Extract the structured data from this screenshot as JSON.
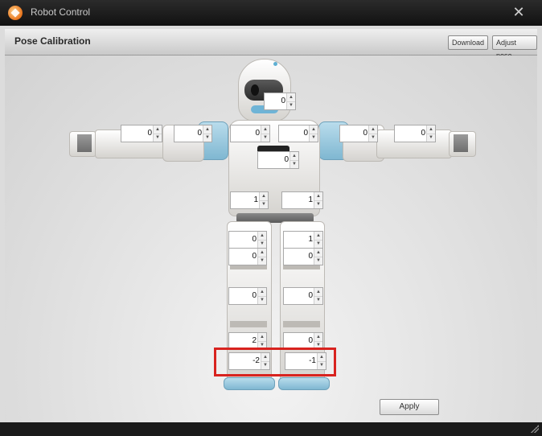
{
  "window": {
    "title": "Robot Control",
    "close_glyph": "✕"
  },
  "header": {
    "title": "Pose Calibration",
    "download_label": "Download",
    "adjust_label": "Adjust pose"
  },
  "servos": {
    "head": "0",
    "left_hand": "0",
    "left_elbow": "0",
    "left_shoulder": "0",
    "right_shoulder": "0",
    "right_elbow": "0",
    "right_hand": "0",
    "chest": "0",
    "left_hip": "1",
    "right_hip": "1",
    "left_thigh_upper": "0",
    "right_thigh_upper": "1",
    "left_thigh_lower": "0",
    "right_thigh_lower": "0",
    "left_knee": "0",
    "right_knee": "0",
    "left_ankle_upper": "2",
    "right_ankle_upper": "0",
    "left_ankle_lower": "-2",
    "right_ankle_lower": "-1"
  },
  "apply_label": "Apply",
  "colors": {
    "highlight": "#d8231f",
    "accent_blue": "#7fb7d1"
  }
}
